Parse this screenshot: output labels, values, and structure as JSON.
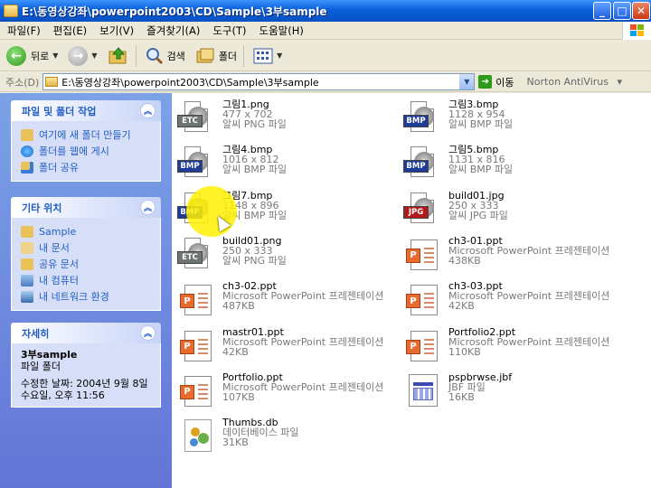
{
  "window": {
    "title": "E:\\동영상강좌\\powerpoint2003\\CD\\Sample\\3부sample"
  },
  "menu": [
    "파일(F)",
    "편집(E)",
    "보기(V)",
    "즐겨찾기(A)",
    "도구(T)",
    "도움말(H)"
  ],
  "toolbar": {
    "back": "뒤로",
    "search": "검색",
    "folders": "폴더"
  },
  "address": {
    "label": "주소(D)",
    "value": "E:\\동영상강좌\\powerpoint2003\\CD\\Sample\\3부sample",
    "go": "이동",
    "norton": "Norton AntiVirus"
  },
  "tasks": {
    "title": "파일 및 폴더 작업",
    "items": [
      "여기에 새 폴더 만들기",
      "폴더를 웹에 게시",
      "폴더 공유"
    ]
  },
  "places": {
    "title": "기타 위치",
    "items": [
      "Sample",
      "내 문서",
      "공유 문서",
      "내 컴퓨터",
      "내 네트워크 환경"
    ]
  },
  "details": {
    "title": "자세히",
    "name": "3부sample",
    "type": "파일 폴더",
    "modified1": "수정한 날짜: 2004년 9월 8일",
    "modified2": "수요일, 오후 11:56"
  },
  "files": [
    {
      "name": "그림1.png",
      "l2": "477 x 702",
      "l3": "알씨 PNG 파일",
      "icon": "etc"
    },
    {
      "name": "그림3.bmp",
      "l2": "1128 x 954",
      "l3": "알씨 BMP 파일",
      "icon": "bmp"
    },
    {
      "name": "그림4.bmp",
      "l2": "1016 x 812",
      "l3": "알씨 BMP 파일",
      "icon": "bmp"
    },
    {
      "name": "그림5.bmp",
      "l2": "1131 x 816",
      "l3": "알씨 BMP 파일",
      "icon": "bmp"
    },
    {
      "name": "그림7.bmp",
      "l2": "1148 x 896",
      "l3": "알씨 BMP 파일",
      "icon": "bmp"
    },
    {
      "name": "build01.jpg",
      "l2": "250 x 333",
      "l3": "알씨 JPG 파일",
      "icon": "jpg"
    },
    {
      "name": "build01.png",
      "l2": "250 x 333",
      "l3": "알씨 PNG 파일",
      "icon": "etc"
    },
    {
      "name": "ch3-01.ppt",
      "l2": "Microsoft PowerPoint 프레젠테이션",
      "l3": "438KB",
      "icon": "ppt"
    },
    {
      "name": "ch3-02.ppt",
      "l2": "Microsoft PowerPoint 프레젠테이션",
      "l3": "487KB",
      "icon": "ppt"
    },
    {
      "name": "ch3-03.ppt",
      "l2": "Microsoft PowerPoint 프레젠테이션",
      "l3": "42KB",
      "icon": "ppt"
    },
    {
      "name": "mastr01.ppt",
      "l2": "Microsoft PowerPoint 프레젠테이션",
      "l3": "42KB",
      "icon": "ppt"
    },
    {
      "name": "Portfolio2.ppt",
      "l2": "Microsoft PowerPoint 프레젠테이션",
      "l3": "110KB",
      "icon": "ppt"
    },
    {
      "name": "Portfolio.ppt",
      "l2": "Microsoft PowerPoint 프레젠테이션",
      "l3": "107KB",
      "icon": "ppt"
    },
    {
      "name": "pspbrwse.jbf",
      "l2": "JBF 파일",
      "l3": "16KB",
      "icon": "jbf"
    },
    {
      "name": "Thumbs.db",
      "l2": "데이터베이스 파일",
      "l3": "31KB",
      "icon": "db"
    }
  ],
  "icon_badges": {
    "etc": "ETC",
    "bmp": "BMP",
    "jpg": "JPG",
    "ppt": "P"
  }
}
